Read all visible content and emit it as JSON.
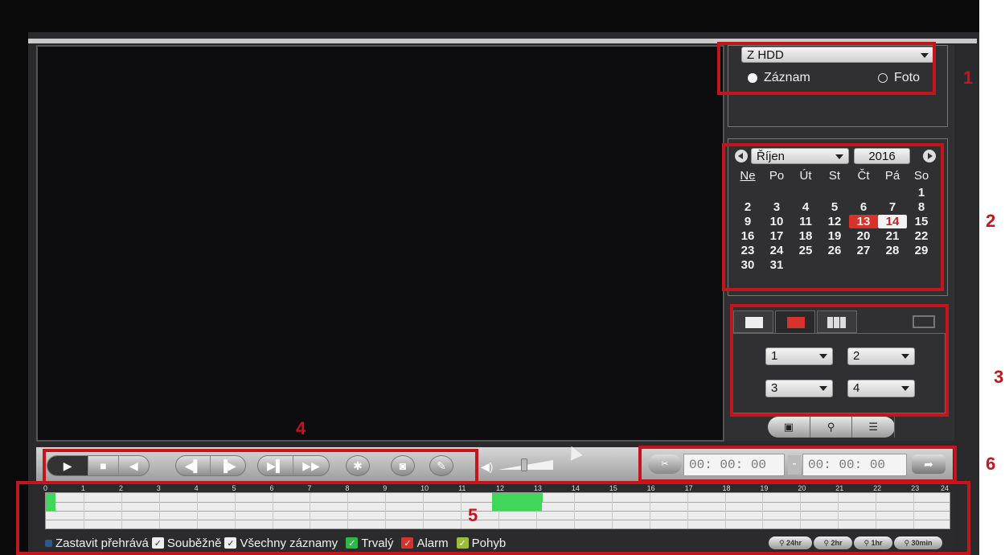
{
  "source": {
    "select_value": "Z HDD",
    "radio_record": "Záznam",
    "radio_photo": "Foto"
  },
  "calendar": {
    "month": "Říjen",
    "year": "2016",
    "weekdays": [
      "Ne",
      "Po",
      "Út",
      "St",
      "Čt",
      "Pá",
      "So"
    ],
    "weeks": [
      [
        "",
        "",
        "",
        "",
        "",
        "",
        "1"
      ],
      [
        "2",
        "3",
        "4",
        "5",
        "6",
        "7",
        "8"
      ],
      [
        "9",
        "10",
        "11",
        "12",
        "13",
        "14",
        "15"
      ],
      [
        "16",
        "17",
        "18",
        "19",
        "20",
        "21",
        "22"
      ],
      [
        "23",
        "24",
        "25",
        "26",
        "27",
        "28",
        "29"
      ],
      [
        "30",
        "31",
        "",
        "",
        "",
        "",
        ""
      ]
    ],
    "highlight_red": "13",
    "highlight_white": "14"
  },
  "split": {
    "channel_1": "1",
    "channel_2": "2",
    "channel_3": "3",
    "channel_4": "4"
  },
  "time": {
    "start": "00: 00: 00",
    "end": "00: 00: 00",
    "separator": "-"
  },
  "timeline": {
    "hours": [
      "0",
      "1",
      "2",
      "3",
      "4",
      "5",
      "6",
      "7",
      "8",
      "9",
      "10",
      "11",
      "12",
      "13",
      "14",
      "15",
      "16",
      "17",
      "18",
      "19",
      "20",
      "21",
      "22",
      "23",
      "24"
    ],
    "record_color": "#3fd65a"
  },
  "legend": {
    "stop_playback": "Zastavit přehrává",
    "sync": "Souběžně",
    "all_records": "Všechny záznamy",
    "continuous": "Trvalý",
    "alarm": "Alarm",
    "motion": "Pohyb"
  },
  "zoom": [
    "24hr",
    "2hr",
    "1hr",
    "30min"
  ],
  "annotations": [
    "1",
    "2",
    "3",
    "4",
    "5",
    "6"
  ],
  "colors": {
    "annotation_red": "#c6141c",
    "check_green": "#2fb84a",
    "check_red": "#d8322c",
    "check_olive": "#9fbb3a"
  }
}
